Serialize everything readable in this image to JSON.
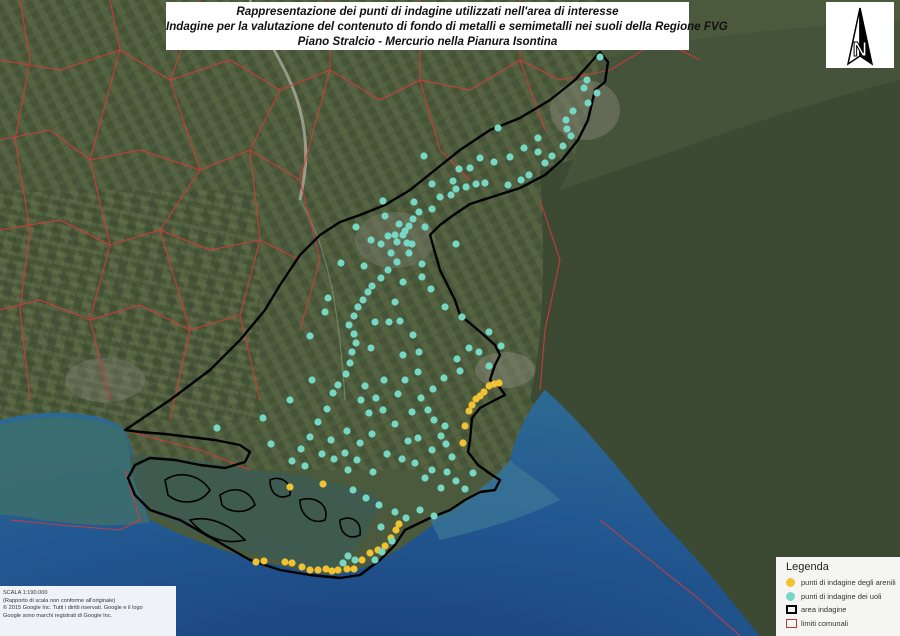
{
  "title": {
    "line1": "Rappresentazione dei punti di indagine utilizzati nell'area di interesse",
    "line2": "Indagine per la valutazione del contenuto di fondo di metalli e semimetalli nei suoli della Regione FVG",
    "line3": "Piano Stralcio - Mercurio nella Pianura Isontina"
  },
  "north_arrow": {
    "icon": "north-arrow-icon",
    "letter": "N"
  },
  "scale": {
    "ratio": "SCALA 1:190.000",
    "note": "(Rapporto di scala non conforme all'originale)",
    "copyright_1": "© 2015 Google Inc. Tutti i diritti riservati. Google e il logo",
    "copyright_2": "Google sono marchi registrati di Google Inc."
  },
  "legend": {
    "title": "Legenda",
    "items": [
      {
        "label": "punti di indagine degli arenili",
        "color": "#f1c232",
        "symbol": "dot"
      },
      {
        "label": "punti di indagine dei uoli",
        "color": "#76d7c4",
        "symbol": "dot"
      },
      {
        "label": "area indagine",
        "color": "#000000",
        "symbol": "outline"
      },
      {
        "label": "limiti comunali",
        "color": "#c0392b",
        "symbol": "outline"
      }
    ]
  },
  "colors": {
    "land": "#4b5a3c",
    "hills": "#3c4a34",
    "sea_deep": "#1f4e8a",
    "sea_light": "#3d7596",
    "lagoon": "#4c6d66",
    "boundary": "#d63a3a",
    "area_outline": "#000000",
    "beach_point": "#f1c232",
    "soil_point": "#76d7c4"
  },
  "points": {
    "arenili": [
      [
        290,
        487
      ],
      [
        323,
        484
      ],
      [
        256,
        562
      ],
      [
        264,
        561
      ],
      [
        285,
        562
      ],
      [
        292,
        563
      ],
      [
        302,
        567
      ],
      [
        310,
        570
      ],
      [
        318,
        570
      ],
      [
        326,
        569
      ],
      [
        332,
        571
      ],
      [
        338,
        570
      ],
      [
        347,
        569
      ],
      [
        354,
        569
      ],
      [
        362,
        560
      ],
      [
        370,
        553
      ],
      [
        378,
        550
      ],
      [
        385,
        546
      ],
      [
        391,
        538
      ],
      [
        396,
        530
      ],
      [
        399,
        524
      ],
      [
        463,
        443
      ],
      [
        465,
        426
      ],
      [
        469,
        411
      ],
      [
        472,
        405
      ],
      [
        476,
        399
      ],
      [
        480,
        396
      ],
      [
        484,
        392
      ],
      [
        489,
        386
      ],
      [
        494,
        384
      ],
      [
        499,
        383
      ]
    ],
    "suoli": [
      [
        600,
        57
      ],
      [
        587,
        80
      ],
      [
        584,
        88
      ],
      [
        597,
        93
      ],
      [
        588,
        103
      ],
      [
        573,
        111
      ],
      [
        566,
        120
      ],
      [
        567,
        129
      ],
      [
        571,
        136
      ],
      [
        563,
        146
      ],
      [
        552,
        156
      ],
      [
        545,
        163
      ],
      [
        538,
        152
      ],
      [
        529,
        175
      ],
      [
        521,
        180
      ],
      [
        508,
        185
      ],
      [
        498,
        128
      ],
      [
        485,
        183
      ],
      [
        476,
        184
      ],
      [
        466,
        187
      ],
      [
        456,
        189
      ],
      [
        451,
        195
      ],
      [
        440,
        197
      ],
      [
        432,
        209
      ],
      [
        419,
        212
      ],
      [
        413,
        219
      ],
      [
        409,
        226
      ],
      [
        403,
        235
      ],
      [
        397,
        242
      ],
      [
        388,
        236
      ],
      [
        381,
        244
      ],
      [
        391,
        253
      ],
      [
        397,
        262
      ],
      [
        388,
        270
      ],
      [
        381,
        278
      ],
      [
        372,
        286
      ],
      [
        368,
        292
      ],
      [
        363,
        300
      ],
      [
        358,
        307
      ],
      [
        354,
        316
      ],
      [
        349,
        325
      ],
      [
        354,
        334
      ],
      [
        356,
        343
      ],
      [
        352,
        352
      ],
      [
        350,
        363
      ],
      [
        346,
        374
      ],
      [
        338,
        385
      ],
      [
        333,
        393
      ],
      [
        327,
        409
      ],
      [
        318,
        422
      ],
      [
        310,
        437
      ],
      [
        301,
        449
      ],
      [
        292,
        461
      ],
      [
        385,
        216
      ],
      [
        383,
        201
      ],
      [
        414,
        202
      ],
      [
        432,
        184
      ],
      [
        453,
        181
      ],
      [
        459,
        169
      ],
      [
        470,
        168
      ],
      [
        480,
        158
      ],
      [
        494,
        162
      ],
      [
        510,
        157
      ],
      [
        524,
        148
      ],
      [
        538,
        138
      ],
      [
        424,
        156
      ],
      [
        456,
        244
      ],
      [
        422,
        264
      ],
      [
        403,
        282
      ],
      [
        395,
        302
      ],
      [
        400,
        321
      ],
      [
        413,
        335
      ],
      [
        419,
        352
      ],
      [
        418,
        372
      ],
      [
        405,
        380
      ],
      [
        384,
        380
      ],
      [
        365,
        386
      ],
      [
        361,
        400
      ],
      [
        369,
        413
      ],
      [
        372,
        434
      ],
      [
        360,
        443
      ],
      [
        345,
        453
      ],
      [
        334,
        459
      ],
      [
        322,
        454
      ],
      [
        387,
        454
      ],
      [
        402,
        459
      ],
      [
        415,
        463
      ],
      [
        432,
        470
      ],
      [
        447,
        472
      ],
      [
        456,
        481
      ],
      [
        465,
        489
      ],
      [
        452,
        457
      ],
      [
        446,
        444
      ],
      [
        441,
        436
      ],
      [
        445,
        426
      ],
      [
        434,
        420
      ],
      [
        428,
        410
      ],
      [
        421,
        398
      ],
      [
        433,
        389
      ],
      [
        444,
        378
      ],
      [
        460,
        371
      ],
      [
        457,
        359
      ],
      [
        469,
        348
      ],
      [
        479,
        352
      ],
      [
        489,
        366
      ],
      [
        501,
        346
      ],
      [
        489,
        332
      ],
      [
        462,
        317
      ],
      [
        445,
        307
      ],
      [
        431,
        289
      ],
      [
        422,
        277
      ],
      [
        409,
        253
      ],
      [
        412,
        244
      ],
      [
        405,
        231
      ],
      [
        425,
        227
      ],
      [
        418,
        438
      ],
      [
        432,
        450
      ],
      [
        408,
        441
      ],
      [
        395,
        424
      ],
      [
        383,
        410
      ],
      [
        376,
        398
      ],
      [
        271,
        444
      ],
      [
        263,
        418
      ],
      [
        217,
        428
      ],
      [
        290,
        400
      ],
      [
        312,
        380
      ],
      [
        328,
        298
      ],
      [
        341,
        263
      ],
      [
        356,
        227
      ],
      [
        310,
        336
      ],
      [
        325,
        312
      ],
      [
        353,
        490
      ],
      [
        366,
        498
      ],
      [
        379,
        505
      ],
      [
        395,
        512
      ],
      [
        406,
        518
      ],
      [
        420,
        510
      ],
      [
        434,
        516
      ],
      [
        381,
        527
      ],
      [
        392,
        541
      ],
      [
        382,
        552
      ],
      [
        348,
        556
      ],
      [
        343,
        563
      ],
      [
        355,
        560
      ],
      [
        375,
        560
      ],
      [
        398,
        394
      ],
      [
        412,
        412
      ],
      [
        441,
        488
      ],
      [
        473,
        473
      ],
      [
        425,
        478
      ],
      [
        373,
        472
      ],
      [
        357,
        460
      ],
      [
        348,
        470
      ],
      [
        331,
        440
      ],
      [
        305,
        466
      ],
      [
        347,
        431
      ],
      [
        403,
        355
      ],
      [
        389,
        322
      ],
      [
        371,
        348
      ],
      [
        375,
        322
      ],
      [
        364,
        266
      ],
      [
        371,
        240
      ],
      [
        395,
        235
      ],
      [
        399,
        224
      ],
      [
        407,
        243
      ]
    ]
  }
}
